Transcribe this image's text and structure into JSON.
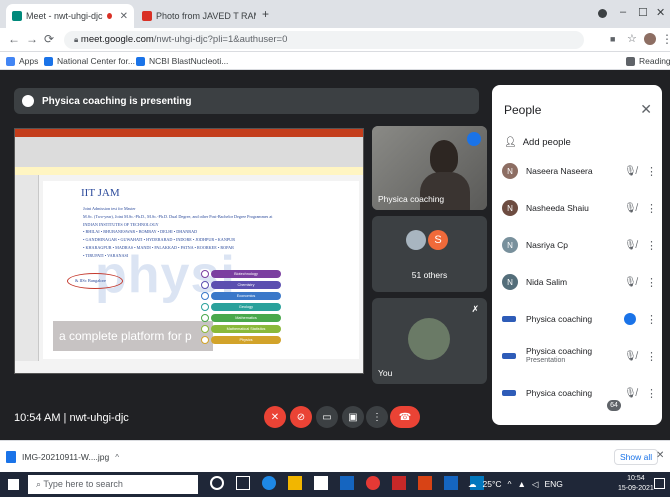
{
  "browser": {
    "tabs": [
      {
        "title": "Meet - nwt-uhgi-djc",
        "active": true
      },
      {
        "title": "Photo from JAVED T RAMZAN - ...",
        "active": false
      }
    ],
    "new_tab": "+",
    "url_host": "meet.google.com",
    "url_rest": "/nwt-uhgi-djc?pli=1&authuser=0",
    "bookmarks": [
      "Apps",
      "National Center for...",
      "NCBI BlastNucleoti..."
    ],
    "reading_list": "Reading list"
  },
  "meet": {
    "presenting_text": "Physica coaching is presenting",
    "tiles": [
      {
        "name": "Physica coaching"
      },
      {
        "name": "51 others",
        "initial": "S"
      },
      {
        "name": "You"
      }
    ],
    "time": "10:54 AM",
    "separator": "|",
    "meeting_code": "nwt-uhgi-djc",
    "people_badge": "64",
    "slide": {
      "heading": "IIT JAM",
      "bullets": [
        "Joint Admission test for Master",
        "M.Sc. (Two-year), Joint M.Sc.-Ph.D., M.Sc.-Ph.D. Dual Degree, and other Post-Bachelor Degree Programmes at",
        "INDIAN INSTITUTES OF TECHNOLOGY",
        "• BHILAI • BHUBANESWAR • BOMBAY • DELHI • DHANBAD",
        "• GANDHINAGAR • GUWAHATI • HYDERABAD • INDORE • JODHPUR • KANPUR",
        "• KHARAGPUR • MADRAS • MANDI • PALAKKAD • PATNA • ROORKEE • ROPAR",
        "• TIRUPATI • VARANASI"
      ],
      "iisc": "& IISc Bangalore",
      "watermark": "physi",
      "tagline": "a complete platform for p",
      "subjects": [
        "Biotechnology",
        "Chemistry",
        "Economics",
        "Geology",
        "Mathematics",
        "Mathematical Statistics",
        "Physics"
      ],
      "subject_colors": [
        "#7b3fa0",
        "#5b4fb0",
        "#3a78c9",
        "#2aa19b",
        "#49a84b",
        "#8ab93a",
        "#d2a32a"
      ]
    }
  },
  "people": {
    "title": "People",
    "add_people": "Add people",
    "list": [
      {
        "initial": "N",
        "name": "Naseera Naseera",
        "sub": "",
        "color": "#8d6e63"
      },
      {
        "initial": "N",
        "name": "Nasheeda Shaiu",
        "sub": "",
        "color": "#6d4c41"
      },
      {
        "initial": "N",
        "name": "Nasriya Cp",
        "sub": "",
        "color": "#78909c"
      },
      {
        "initial": "N",
        "name": "Nida Salim",
        "sub": "",
        "color": "#546e7a"
      },
      {
        "initial": "",
        "name": "Physica coaching",
        "sub": "",
        "color": "#2e5cb8"
      },
      {
        "initial": "",
        "name": "Physica coaching",
        "sub": "Presentation",
        "color": "#2e5cb8"
      },
      {
        "initial": "",
        "name": "Physica coaching",
        "sub": "",
        "color": "#2e5cb8"
      }
    ]
  },
  "downloads": {
    "file": "IMG-20210911-W....jpg",
    "show_all": "Show all"
  },
  "taskbar": {
    "search_placeholder": "Type here to search",
    "weather": "25°C",
    "lang": "ENG",
    "time": "10:54",
    "date": "15-09-2021"
  }
}
